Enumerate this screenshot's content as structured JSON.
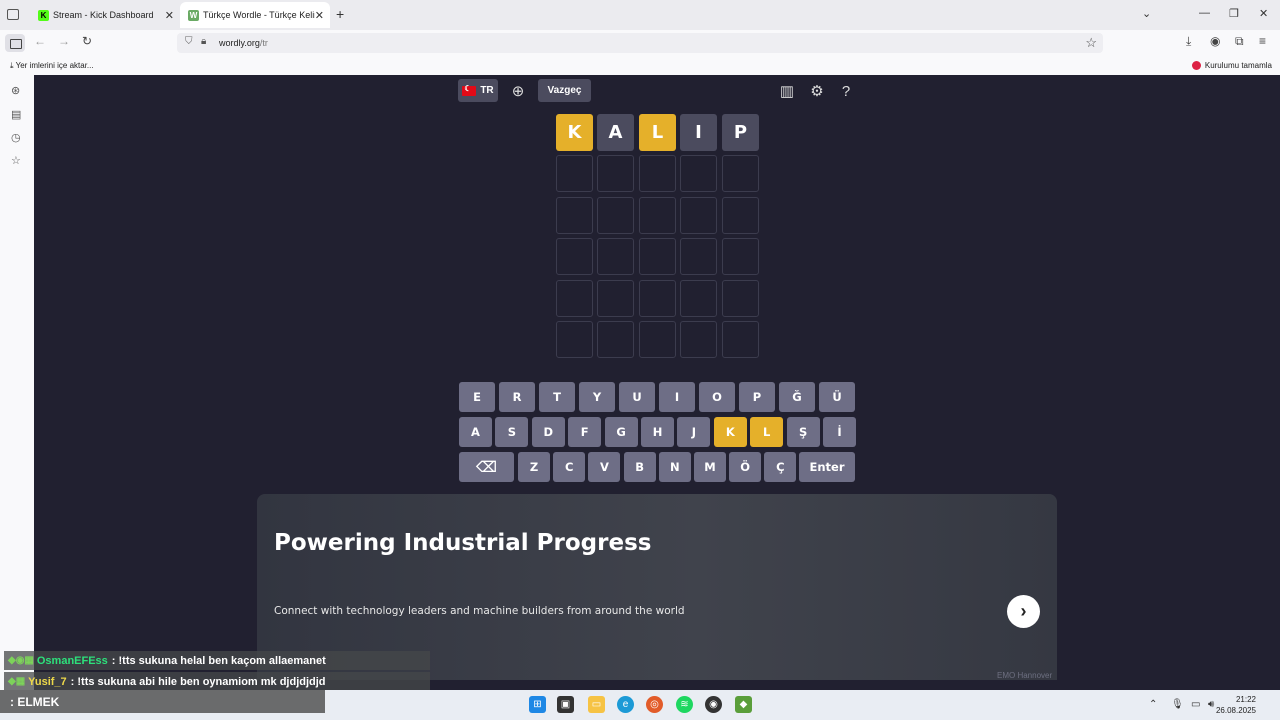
{
  "browser": {
    "tabs": [
      {
        "title": "Stream - Kick Dashboard",
        "favicon_color": "#53fc18",
        "favicon_letter": "K"
      },
      {
        "title": "Türkçe Wordle - Türkçe Kelimel",
        "favicon_color": "#6aaa64",
        "favicon_letter": "W"
      }
    ],
    "url_domain": "wordly.org",
    "url_path": "/tr",
    "bookmark_import": "Yer imlerini içe aktar...",
    "bookmark_right": "Kurulumu tamamla"
  },
  "game": {
    "lang_label": "TR",
    "giveup_label": "Vazgeç",
    "guess": [
      {
        "letter": "K",
        "state": "yellow"
      },
      {
        "letter": "A",
        "state": "gray"
      },
      {
        "letter": "L",
        "state": "yellow"
      },
      {
        "letter": "I",
        "state": "gray"
      },
      {
        "letter": "P",
        "state": "gray"
      }
    ],
    "keyboard": {
      "row1": [
        "E",
        "R",
        "T",
        "Y",
        "U",
        "I",
        "O",
        "P",
        "Ğ",
        "Ü"
      ],
      "row2": [
        "A",
        "S",
        "D",
        "F",
        "G",
        "H",
        "J",
        "K",
        "L",
        "Ş",
        "İ"
      ],
      "row3": [
        "Z",
        "C",
        "V",
        "B",
        "N",
        "M",
        "Ö",
        "Ç"
      ],
      "enter": "Enter",
      "highlighted": [
        "K",
        "L"
      ]
    }
  },
  "ad": {
    "title": "Powering Industrial Progress",
    "subtitle": "Connect with technology leaders and machine builders from around the world",
    "source": "EMO Hannover"
  },
  "chat": [
    {
      "user": "OsmanEFEss",
      "message": ": !tts sukuna helal ben kaçom allaemanet"
    },
    {
      "user": "Yusif_7",
      "message": ": !tts sukuna abi hile ben oynamiom mk djdjdjdjd"
    }
  ],
  "overlay_word": ": ELMEK",
  "taskbar": {
    "time": "21:22",
    "date": "26.08.2025"
  }
}
